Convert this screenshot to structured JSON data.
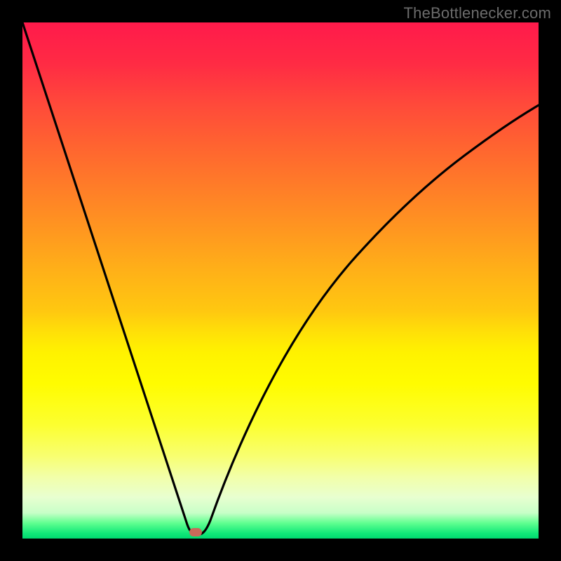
{
  "watermark": "TheBottlenecker.com",
  "chart_data": {
    "type": "line",
    "title": "",
    "xlabel": "",
    "ylabel": "",
    "x_range": [
      0,
      100
    ],
    "y_range": [
      0,
      100
    ],
    "series": [
      {
        "name": "bottleneck-curve",
        "x": [
          0,
          2,
          4,
          6,
          8,
          10,
          12,
          14,
          16,
          18,
          20,
          22,
          24,
          26,
          28,
          30,
          31,
          32,
          33,
          34,
          35,
          36,
          38,
          40,
          42,
          44,
          46,
          48,
          50,
          54,
          58,
          62,
          66,
          70,
          74,
          78,
          82,
          86,
          90,
          94,
          98,
          100
        ],
        "y": [
          100,
          94,
          88,
          82,
          76,
          70,
          64,
          58,
          51,
          45,
          39,
          32,
          26,
          19,
          13,
          6,
          3,
          1,
          0.2,
          0.3,
          1,
          3,
          8,
          14,
          20,
          26,
          32,
          37,
          42,
          50,
          57,
          62,
          67,
          71,
          74,
          77,
          80,
          82,
          84,
          85.5,
          87,
          87.5
        ]
      }
    ],
    "marker": {
      "x": 33,
      "y": 0
    },
    "gradient_stops": [
      {
        "pos": 0,
        "color": "#ff1a4b"
      },
      {
        "pos": 50,
        "color": "#ffd000"
      },
      {
        "pos": 100,
        "color": "#00d870"
      }
    ]
  }
}
